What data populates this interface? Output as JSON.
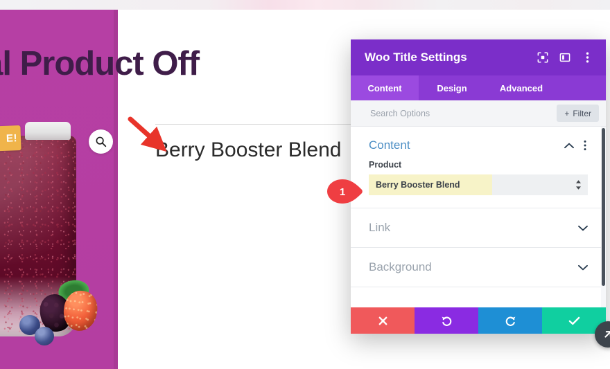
{
  "page": {
    "hero_heading": "ecial Product Off",
    "hero_heading_full": "Special Product Offer",
    "product_title": "Berry Booster Blend",
    "sale_badge": "E!",
    "sale_badge_full": "SALE!",
    "search_icon_name": "magnifier-icon"
  },
  "modal": {
    "title": "Woo Title Settings",
    "header_icons": {
      "focus": "focus-target-icon",
      "layout": "panel-layout-icon",
      "menu": "kebab-menu-icon"
    },
    "tabs": [
      {
        "label": "Content",
        "active": true
      },
      {
        "label": "Design",
        "active": false
      },
      {
        "label": "Advanced",
        "active": false
      }
    ],
    "search": {
      "placeholder": "Search Options",
      "value": ""
    },
    "filter_button": {
      "label": "Filter",
      "plus": "+"
    },
    "sections": [
      {
        "title": "Content",
        "state": "expanded",
        "fields": [
          {
            "label": "Product",
            "type": "select",
            "value": "Berry Booster Blend"
          }
        ]
      },
      {
        "title": "Link",
        "state": "collapsed"
      },
      {
        "title": "Background",
        "state": "collapsed"
      }
    ],
    "footer_buttons": [
      {
        "name": "cancel",
        "glyph": "✕",
        "color": "#f0595b"
      },
      {
        "name": "undo",
        "glyph": "↺",
        "color": "#8a2be2"
      },
      {
        "name": "redo",
        "glyph": "↻",
        "color": "#1e8fd5"
      },
      {
        "name": "save",
        "glyph": "✓",
        "color": "#10cfa0"
      }
    ]
  },
  "annotations": {
    "callout_number": "1",
    "callout_color": "#ef3e42",
    "arrow_color": "#e8342a"
  },
  "colors": {
    "brand_purple": "#7b2ec9",
    "tab_bar": "#8a3ad4",
    "tab_active": "#9b4ae0",
    "left_panel_magenta": "#b5419f",
    "heading_purple": "#3f1d49",
    "section_blue": "#4c8ec4",
    "highlight_yellow": "#f7f3c8",
    "sale_orange": "#f0b44a"
  }
}
